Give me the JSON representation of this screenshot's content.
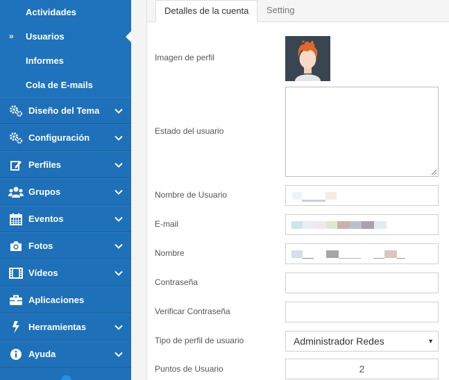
{
  "sidebar": {
    "subitems": [
      {
        "label": "Actividades",
        "active": false
      },
      {
        "label": "Usuarios",
        "active": true,
        "marker": "»"
      },
      {
        "label": "Informes",
        "active": false
      },
      {
        "label": "Cola de E-mails",
        "active": false
      }
    ],
    "items": [
      {
        "label": "Diseño del Tema",
        "icon": "gears-icon",
        "expandable": true
      },
      {
        "label": "Configuración",
        "icon": "gears-icon",
        "expandable": true
      },
      {
        "label": "Perfiles",
        "icon": "edit-icon",
        "expandable": true
      },
      {
        "label": "Grupos",
        "icon": "users-icon",
        "expandable": true
      },
      {
        "label": "Eventos",
        "icon": "calendar-icon",
        "expandable": true
      },
      {
        "label": "Fotos",
        "icon": "camera-icon",
        "expandable": true
      },
      {
        "label": "Vídeos",
        "icon": "film-icon",
        "expandable": true
      },
      {
        "label": "Aplicaciones",
        "icon": "briefcase-icon",
        "expandable": false
      },
      {
        "label": "Herramientas",
        "icon": "bolt-icon",
        "expandable": true
      },
      {
        "label": "Ayuda",
        "icon": "info-icon",
        "expandable": true
      }
    ],
    "colors": {
      "background": "#1e70b9",
      "text": "#ffffff"
    }
  },
  "tabs": [
    {
      "label": "Detalles de la cuenta",
      "active": true
    },
    {
      "label": "Setting",
      "active": false
    }
  ],
  "form": {
    "profile_image_label": "Imagen de perfil",
    "status_label": "Estado del usuario",
    "status_value": "",
    "username_label": "Nombre de Usuario",
    "email_label": "E-mail",
    "name_label": "Nombre",
    "password_label": "Contraseña",
    "password_value": "",
    "verify_password_label": "Verificar Contraseña",
    "verify_password_value": "",
    "profile_type_label": "Tipo de perfil de usuario",
    "profile_type_value": "Administrador Redes",
    "points_label": "Puntos de Usuario",
    "points_value": "2"
  }
}
